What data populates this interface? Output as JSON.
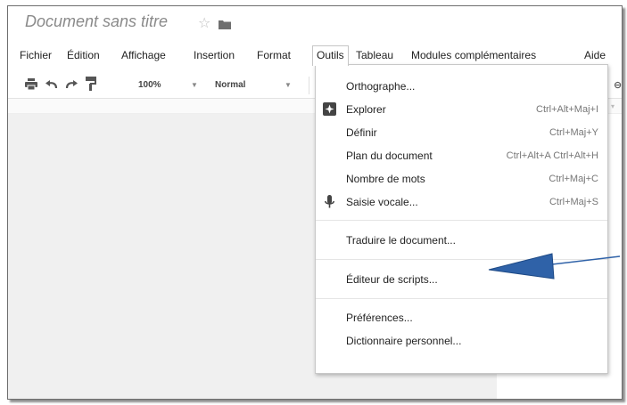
{
  "document": {
    "title": "Document sans titre"
  },
  "menubar": {
    "items": [
      {
        "label": "Fichier"
      },
      {
        "label": "Édition"
      },
      {
        "label": "Affichage"
      },
      {
        "label": "Insertion"
      },
      {
        "label": "Format"
      },
      {
        "label": "Outils"
      },
      {
        "label": "Tableau"
      },
      {
        "label": "Modules complémentaires"
      },
      {
        "label": "Aide"
      }
    ],
    "open_menu": "Outils"
  },
  "toolbar": {
    "zoom": "100%",
    "style": "Normal",
    "icons": [
      "print-icon",
      "undo-icon",
      "redo-icon",
      "paint-format-icon",
      "link-icon"
    ]
  },
  "tools_menu": {
    "items": [
      {
        "label": "Orthographe...",
        "shortcut": "",
        "icon": ""
      },
      {
        "label": "Explorer",
        "shortcut": "Ctrl+Alt+Maj+I",
        "icon": "explore-icon"
      },
      {
        "label": "Définir",
        "shortcut": "Ctrl+Maj+Y",
        "icon": ""
      },
      {
        "label": "Plan du document",
        "shortcut": "Ctrl+Alt+A Ctrl+Alt+H",
        "icon": ""
      },
      {
        "label": "Nombre de mots",
        "shortcut": "Ctrl+Maj+C",
        "icon": ""
      },
      {
        "label": "Saisie vocale...",
        "shortcut": "Ctrl+Maj+S",
        "icon": "microphone-icon"
      },
      {
        "label": "Traduire le document...",
        "shortcut": "",
        "icon": ""
      },
      {
        "label": "Éditeur de scripts...",
        "shortcut": "",
        "icon": ""
      },
      {
        "label": "Préférences...",
        "shortcut": "",
        "icon": ""
      },
      {
        "label": "Dictionnaire personnel...",
        "shortcut": "",
        "icon": ""
      }
    ]
  },
  "annotation": {
    "arrow_color": "#2f62a8",
    "points_to": "Traduire le document..."
  },
  "colors": {
    "title": "#8a8a8a",
    "menu_text": "#222222",
    "shortcut_text": "#777777",
    "canvas": "#f0f0f0"
  }
}
